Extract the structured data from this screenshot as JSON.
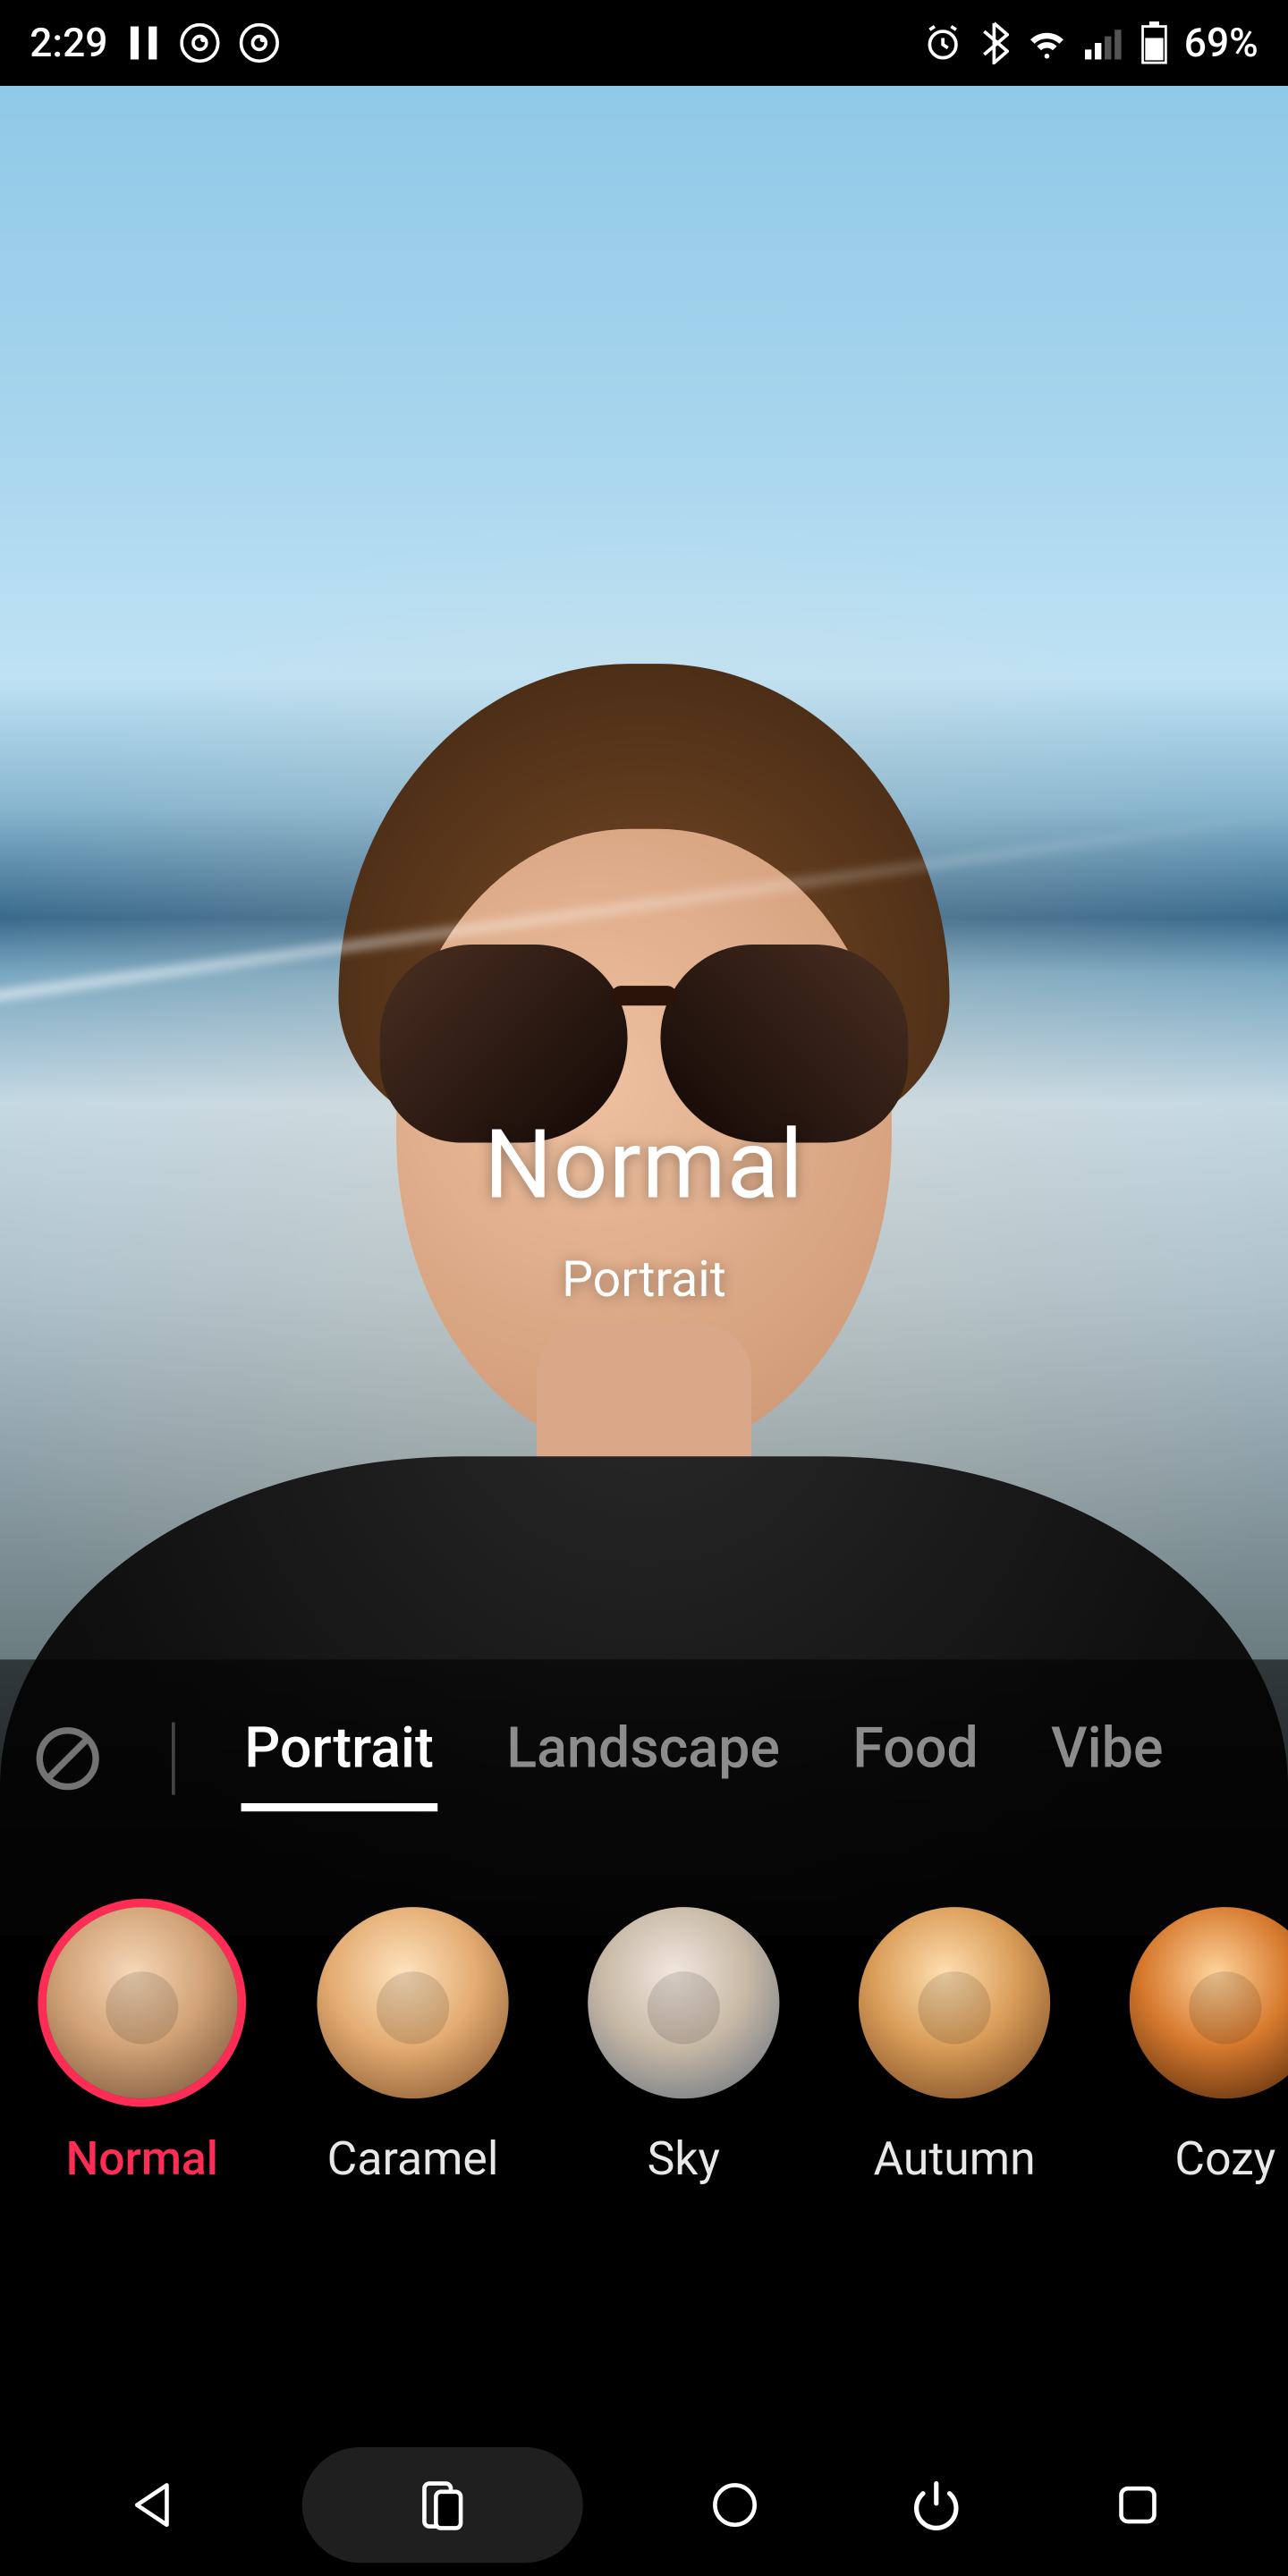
{
  "status": {
    "time": "2:29",
    "battery": "69%",
    "left_icons": [
      "pause-icon",
      "app-icon-a",
      "app-icon-a"
    ],
    "right_icons": [
      "alarm-icon",
      "bluetooth-icon",
      "wifi-icon",
      "signal-icon",
      "battery-icon"
    ]
  },
  "overlay": {
    "filter_name": "Normal",
    "category_name": "Portrait"
  },
  "categories": [
    {
      "id": "none",
      "label": ""
    },
    {
      "id": "portrait",
      "label": "Portrait",
      "active": true
    },
    {
      "id": "landscape",
      "label": "Landscape"
    },
    {
      "id": "food",
      "label": "Food"
    },
    {
      "id": "vibe",
      "label": "Vibe"
    }
  ],
  "filters": [
    {
      "id": "normal",
      "label": "Normal",
      "active": true,
      "tone": ""
    },
    {
      "id": "caramel",
      "label": "Caramel",
      "tone": "warm"
    },
    {
      "id": "sky",
      "label": "Sky",
      "tone": "cool"
    },
    {
      "id": "autumn",
      "label": "Autumn",
      "tone": "autumn"
    },
    {
      "id": "cozy",
      "label": "Cozy",
      "tone": "cozy"
    }
  ],
  "nav": {
    "buttons": [
      "back",
      "lens-switch",
      "home",
      "power",
      "overview"
    ]
  },
  "colors": {
    "accent": "#ff2d55"
  }
}
